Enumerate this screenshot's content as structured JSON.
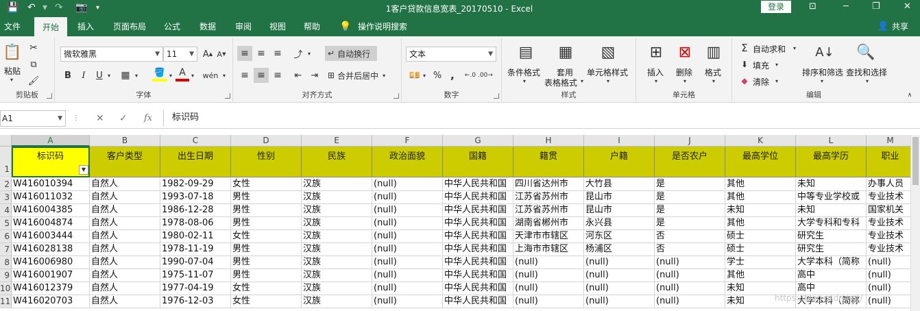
{
  "title": "1客户贷款信息宽表_20170510 - Excel",
  "login_label": "登录",
  "share_label": "共享",
  "tabs": [
    "文件",
    "开始",
    "插入",
    "页面布局",
    "公式",
    "数据",
    "审阅",
    "视图",
    "帮助"
  ],
  "tell_me": "操作说明搜索",
  "ribbon": {
    "paste": "粘贴",
    "clipboard": "剪贴板",
    "font_name": "微软雅黑",
    "font_size": "11",
    "font_group": "字体",
    "bold": "B",
    "italic": "I",
    "underline": "U",
    "wen": "wén",
    "wrap": "自动换行",
    "merge": "合并后居中",
    "align_group": "对齐方式",
    "number_format": "文本",
    "percent": "%",
    "comma": ",",
    "number_group": "数字",
    "cond_format": "条件格式",
    "table_format_1": "套用",
    "table_format_2": "表格格式",
    "cell_style": "单元格样式",
    "styles_group": "样式",
    "insert": "插入",
    "delete": "删除",
    "format": "格式",
    "cells_group": "单元格",
    "autosum": "自动求和",
    "fill": "填充",
    "clear": "清除",
    "sort_filter": "排序和筛选",
    "find_select": "查找和选择",
    "edit_group": "编辑"
  },
  "formula_bar": {
    "name_box": "A1",
    "fx": "fx",
    "content": "标识码"
  },
  "columns": [
    "A",
    "B",
    "C",
    "D",
    "E",
    "F",
    "G",
    "H",
    "I",
    "J",
    "K",
    "L",
    "M"
  ],
  "headers": [
    "标识码",
    "客户类型",
    "出生日期",
    "性别",
    "民族",
    "政治面貌",
    "国籍",
    "籍贯",
    "户籍",
    "是否农户",
    "最高学位",
    "最高学历",
    "职业"
  ],
  "rows": [
    {
      "n": "2",
      "c": [
        "W416010394",
        "自然人",
        "1982-09-29",
        "女性",
        "汉族",
        "(null)",
        "中华人民共和国",
        "四川省达州市",
        "大竹县",
        "是",
        "其他",
        "未知",
        "办事人员"
      ]
    },
    {
      "n": "3",
      "c": [
        "W416011032",
        "自然人",
        "1993-07-18",
        "男性",
        "汉族",
        "(null)",
        "中华人民共和国",
        "江苏省苏州市",
        "昆山市",
        "是",
        "其他",
        "中等专业学校或",
        "专业技术"
      ]
    },
    {
      "n": "4",
      "c": [
        "W416004385",
        "自然人",
        "1986-12-28",
        "男性",
        "汉族",
        "(null)",
        "中华人民共和国",
        "江苏省苏州市",
        "昆山市",
        "是",
        "未知",
        "未知",
        "国家机关"
      ]
    },
    {
      "n": "5",
      "c": [
        "W416004874",
        "自然人",
        "1978-08-06",
        "男性",
        "汉族",
        "(null)",
        "中华人民共和国",
        "湖南省郴州市",
        "永兴县",
        "是",
        "其他",
        "大学专科和专科",
        "专业技术"
      ]
    },
    {
      "n": "6",
      "c": [
        "W416003444",
        "自然人",
        "1980-02-11",
        "女性",
        "汉族",
        "(null)",
        "中华人民共和国",
        "天津市市辖区",
        "河东区",
        "否",
        "硕士",
        "研究生",
        "专业技术"
      ]
    },
    {
      "n": "7",
      "c": [
        "W416028138",
        "自然人",
        "1978-11-19",
        "男性",
        "汉族",
        "(null)",
        "中华人民共和国",
        "上海市市辖区",
        "杨浦区",
        "否",
        "硕士",
        "研究生",
        "专业技术"
      ]
    },
    {
      "n": "8",
      "c": [
        "W416006980",
        "自然人",
        "1990-07-04",
        "男性",
        "汉族",
        "(null)",
        "中华人民共和国",
        "(null)",
        "(null)",
        "(null)",
        "学士",
        "大学本科（简称",
        "(null)"
      ]
    },
    {
      "n": "9",
      "c": [
        "W416001907",
        "自然人",
        "1975-11-07",
        "男性",
        "汉族",
        "(null)",
        "中华人民共和国",
        "(null)",
        "(null)",
        "(null)",
        "其他",
        "高中",
        "(null)"
      ]
    },
    {
      "n": "10",
      "c": [
        "W416012379",
        "自然人",
        "1977-04-19",
        "女性",
        "汉族",
        "(null)",
        "中华人民共和国",
        "(null)",
        "(null)",
        "(null)",
        "未知",
        "高中",
        "(null)"
      ]
    },
    {
      "n": "11",
      "c": [
        "W416020703",
        "自然人",
        "1976-12-03",
        "女性",
        "汉族",
        "(null)",
        "中华人民共和国",
        "(null)",
        "(null)",
        "(null)",
        "未知",
        "大学本科（简称",
        "(null)"
      ]
    }
  ],
  "watermark": "https://blog.csdn.net/"
}
